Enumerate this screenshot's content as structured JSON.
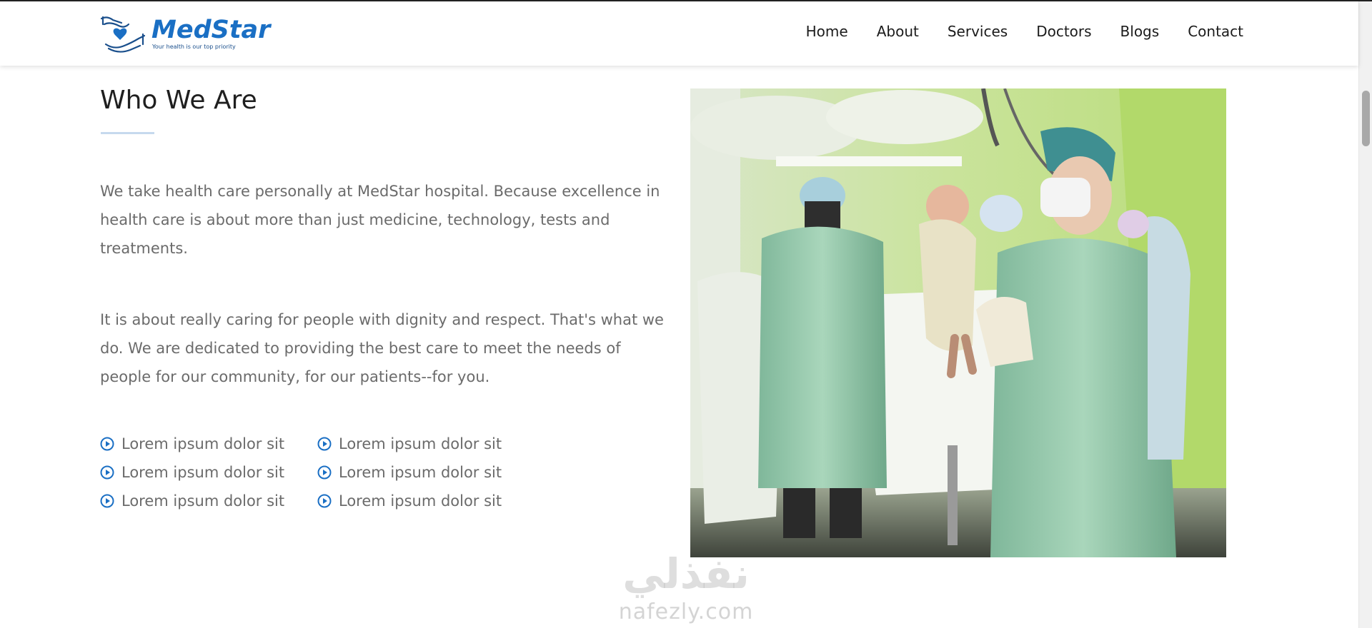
{
  "brand": {
    "name": "MedStar",
    "tagline": "Your health is our top priority",
    "color": "#1a6fc4"
  },
  "nav": {
    "items": [
      {
        "label": "Home"
      },
      {
        "label": "About"
      },
      {
        "label": "Services"
      },
      {
        "label": "Doctors"
      },
      {
        "label": "Blogs"
      },
      {
        "label": "Contact"
      }
    ]
  },
  "section": {
    "title": "Who We Are",
    "paragraph1": "We take health care personally at MedStar hospital. Because excellence in health care is about more than just medicine, technology, tests and treatments.",
    "paragraph2": "It is about really caring for people with dignity and respect. That's what we do. We are dedicated to providing the best care to meet the needs of people for our community, for our patients--for you.",
    "features": [
      "Lorem ipsum dolor sit",
      "Lorem ipsum dolor sit",
      "Lorem ipsum dolor sit",
      "Lorem ipsum dolor sit",
      "Lorem ipsum dolor sit",
      "Lorem ipsum dolor sit"
    ],
    "feature_icon": "play-circle-icon",
    "accent_color": "#1a6fc4"
  },
  "watermark": {
    "arabic": "نفذلي",
    "latin": "nafezly.com"
  }
}
